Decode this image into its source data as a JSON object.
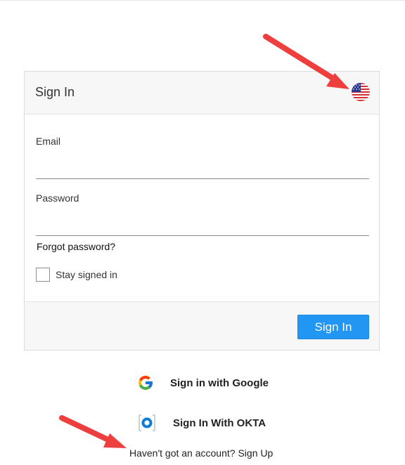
{
  "card": {
    "title": "Sign In",
    "language_icon": "us-flag-icon"
  },
  "form": {
    "email_label": "Email",
    "email_value": "",
    "password_label": "Password",
    "password_value": "",
    "forgot_link": "Forgot password?",
    "stay_signed_in_label": "Stay signed in",
    "stay_signed_in_checked": false,
    "submit_label": "Sign In"
  },
  "social": {
    "google_label": "Sign in with Google",
    "okta_label": "Sign In With OKTA"
  },
  "signup": {
    "prompt": "Haven't got an account?",
    "link": "Sign Up"
  },
  "colors": {
    "primary_button": "#2196f3",
    "annotation_arrow": "#ee3f3f",
    "header_bg": "#f7f7f7"
  }
}
